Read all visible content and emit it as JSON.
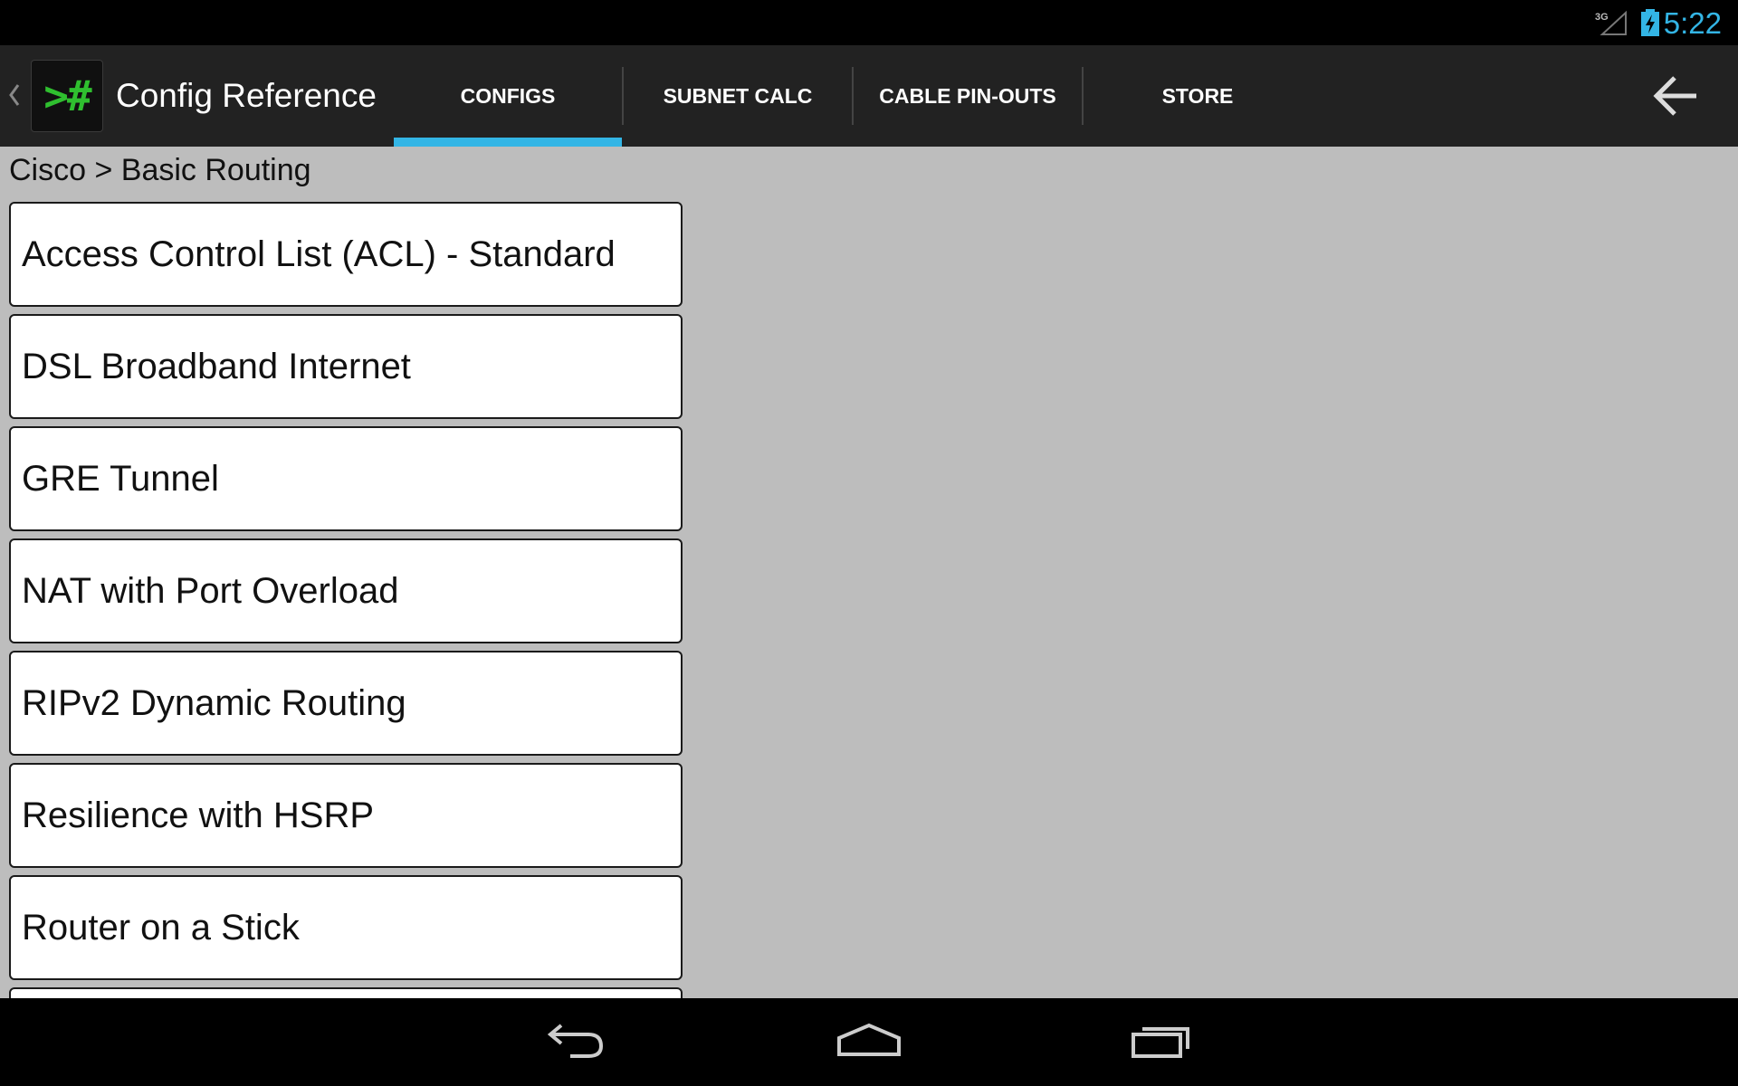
{
  "status_bar": {
    "network": "3G",
    "time": "5:22",
    "accent_color": "#33b5e5"
  },
  "action_bar": {
    "app_title": "Config Reference",
    "app_icon_text": ">#",
    "tabs": [
      {
        "label": "CONFIGS",
        "selected": true
      },
      {
        "label": "SUBNET CALC",
        "selected": false
      },
      {
        "label": "CABLE PIN-OUTS",
        "selected": false
      },
      {
        "label": "STORE",
        "selected": false
      }
    ],
    "indicator_color": "#33b5e5"
  },
  "content": {
    "breadcrumb": "Cisco > Basic Routing",
    "items": [
      {
        "label": "Access Control List (ACL) - Standard"
      },
      {
        "label": "DSL Broadband Internet"
      },
      {
        "label": "GRE Tunnel"
      },
      {
        "label": "NAT with Port Overload"
      },
      {
        "label": "RIPv2 Dynamic Routing"
      },
      {
        "label": "Resilience with HSRP"
      },
      {
        "label": "Router on a Stick"
      },
      {
        "label": ""
      }
    ]
  },
  "nav_bar": {
    "buttons": [
      "back-icon",
      "home-icon",
      "recent-apps-icon"
    ]
  }
}
